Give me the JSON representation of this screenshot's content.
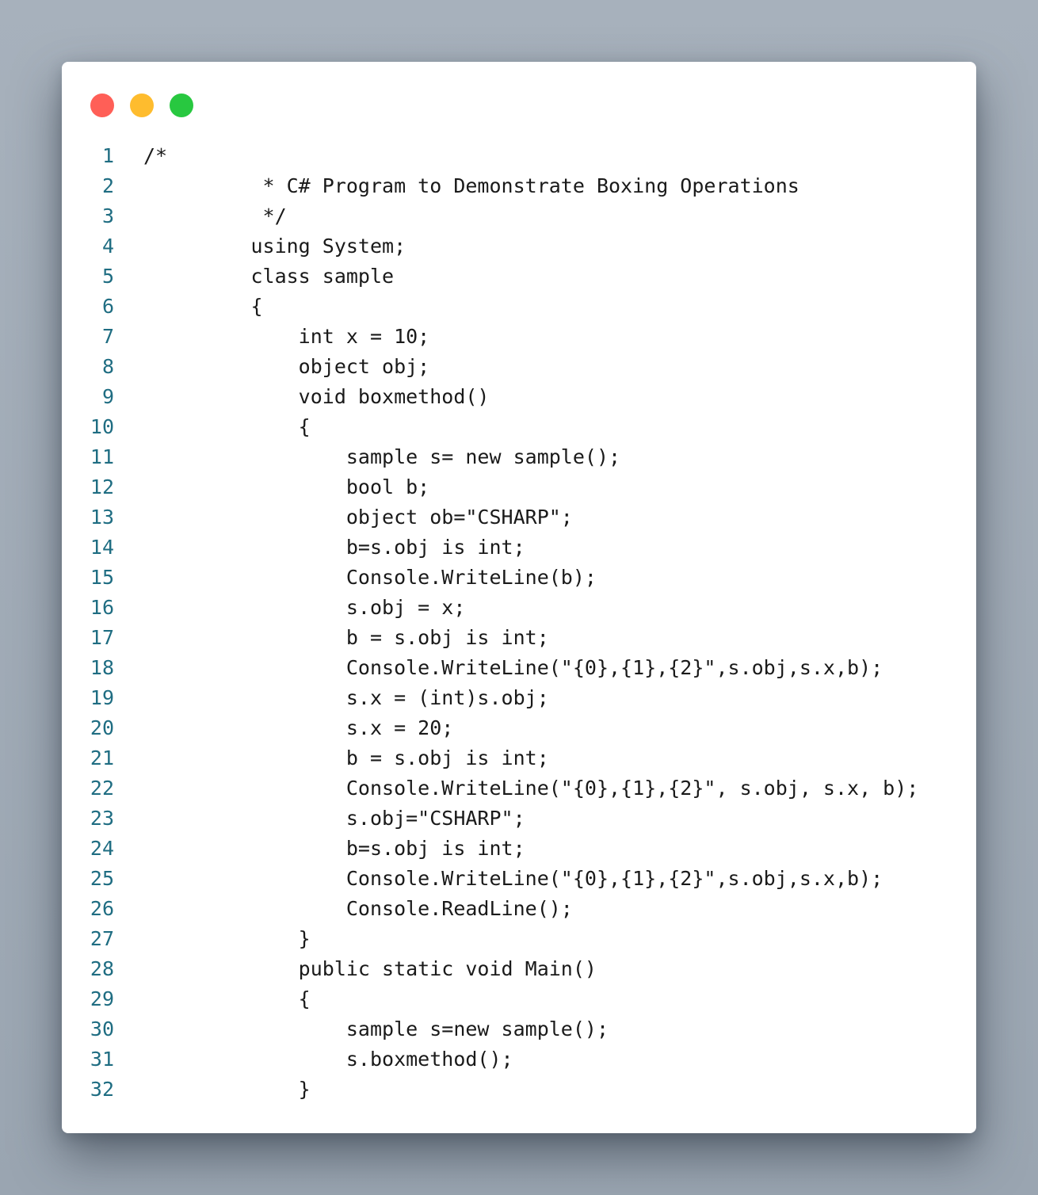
{
  "window": {
    "controls": [
      {
        "name": "close",
        "color": "#ff5f57"
      },
      {
        "name": "minimize",
        "color": "#febc2e"
      },
      {
        "name": "zoom",
        "color": "#28c840"
      }
    ]
  },
  "code": {
    "language": "C#",
    "lines": [
      {
        "n": "1",
        "text": "/*"
      },
      {
        "n": "2",
        "text": "          * C# Program to Demonstrate Boxing Operations"
      },
      {
        "n": "3",
        "text": "          */"
      },
      {
        "n": "4",
        "text": "         using System;"
      },
      {
        "n": "5",
        "text": "         class sample"
      },
      {
        "n": "6",
        "text": "         {"
      },
      {
        "n": "7",
        "text": "             int x = 10;"
      },
      {
        "n": "8",
        "text": "             object obj;"
      },
      {
        "n": "9",
        "text": "             void boxmethod()"
      },
      {
        "n": "10",
        "text": "             {"
      },
      {
        "n": "11",
        "text": "                 sample s= new sample();"
      },
      {
        "n": "12",
        "text": "                 bool b;"
      },
      {
        "n": "13",
        "text": "                 object ob=\"CSHARP\";"
      },
      {
        "n": "14",
        "text": "                 b=s.obj is int;"
      },
      {
        "n": "15",
        "text": "                 Console.WriteLine(b);"
      },
      {
        "n": "16",
        "text": "                 s.obj = x;"
      },
      {
        "n": "17",
        "text": "                 b = s.obj is int;"
      },
      {
        "n": "18",
        "text": "                 Console.WriteLine(\"{0},{1},{2}\",s.obj,s.x,b);"
      },
      {
        "n": "19",
        "text": "                 s.x = (int)s.obj;"
      },
      {
        "n": "20",
        "text": "                 s.x = 20;"
      },
      {
        "n": "21",
        "text": "                 b = s.obj is int;"
      },
      {
        "n": "22",
        "text": "                 Console.WriteLine(\"{0},{1},{2}\", s.obj, s.x, b);"
      },
      {
        "n": "23",
        "text": "                 s.obj=\"CSHARP\";"
      },
      {
        "n": "24",
        "text": "                 b=s.obj is int;"
      },
      {
        "n": "25",
        "text": "                 Console.WriteLine(\"{0},{1},{2}\",s.obj,s.x,b);"
      },
      {
        "n": "26",
        "text": "                 Console.ReadLine();"
      },
      {
        "n": "27",
        "text": "             }"
      },
      {
        "n": "28",
        "text": "             public static void Main()"
      },
      {
        "n": "29",
        "text": "             {"
      },
      {
        "n": "30",
        "text": "                 sample s=new sample();"
      },
      {
        "n": "31",
        "text": "                 s.boxmethod();"
      },
      {
        "n": "32",
        "text": "             }"
      }
    ]
  }
}
